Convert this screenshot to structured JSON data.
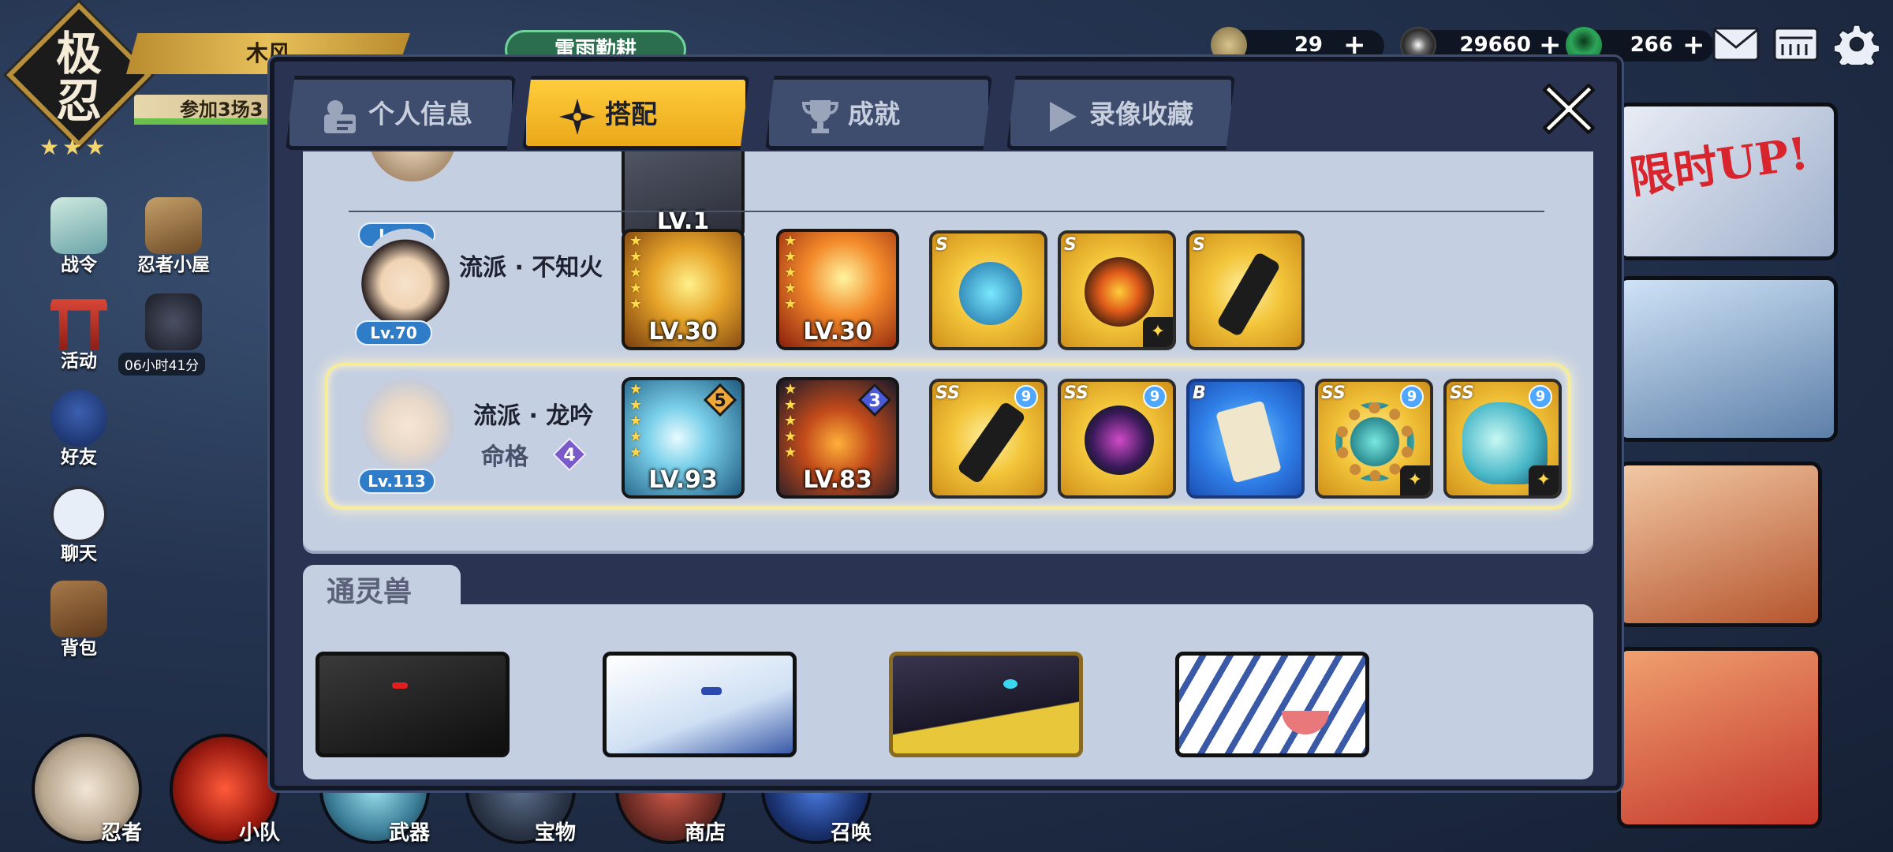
{
  "background": {
    "emblem_glyph_1": "极",
    "emblem_glyph_2": "忍",
    "player_name": "木风",
    "quest_text": "参加3场3",
    "event_pill": "雷雨勤耕",
    "event_banner_text": "限时UP!",
    "side_menu": [
      {
        "label": "战令"
      },
      {
        "label": "忍者小屋"
      },
      {
        "label": "活动"
      },
      {
        "label": "好友"
      },
      {
        "label": "聊天"
      },
      {
        "label": "背包"
      }
    ],
    "side_timer": "06小时41分",
    "bottom_nav": [
      {
        "label": "忍者"
      },
      {
        "label": "小队"
      },
      {
        "label": "武器"
      },
      {
        "label": "宝物"
      },
      {
        "label": "商店"
      },
      {
        "label": "召唤"
      }
    ],
    "currencies": [
      {
        "icon": "coin-icon",
        "value": "29"
      },
      {
        "icon": "silver-coin-icon",
        "value": "29660"
      },
      {
        "icon": "jade-icon",
        "value": "266"
      }
    ]
  },
  "modal": {
    "tabs": [
      {
        "label": "个人信息",
        "icon": "profile-card-icon",
        "active": false
      },
      {
        "label": "搭配",
        "icon": "shuriken-icon",
        "active": true
      },
      {
        "label": "成就",
        "icon": "trophy-icon",
        "active": false
      },
      {
        "label": "录像收藏",
        "icon": "play-icon",
        "active": false
      }
    ],
    "rows": [
      {
        "level": "Lv.1",
        "weapon_level": "LV.1"
      },
      {
        "level": "Lv.70",
        "school": "流派 · 不知火",
        "weapons": [
          {
            "level": "LV.30",
            "stars": 5
          },
          {
            "level": "LV.30",
            "stars": 5
          }
        ],
        "items": [
          {
            "grade": "S",
            "tag": ""
          },
          {
            "grade": "S",
            "tag": "✦"
          },
          {
            "grade": "S",
            "tag": ""
          }
        ]
      },
      {
        "level": "Lv.113",
        "school": "流派 · 龙吟",
        "destiny_label": "命格",
        "destiny_value": "4",
        "selected": true,
        "weapons": [
          {
            "level": "LV.93",
            "stars": 5,
            "rank": "5"
          },
          {
            "level": "LV.83",
            "stars": 5,
            "rank": "3"
          }
        ],
        "items": [
          {
            "grade": "SS",
            "bubble": "9",
            "tag": "",
            "color": "gold"
          },
          {
            "grade": "SS",
            "bubble": "9",
            "tag": "",
            "color": "gold"
          },
          {
            "grade": "B",
            "bubble": "",
            "tag": "",
            "color": "blue"
          },
          {
            "grade": "SS",
            "bubble": "9",
            "tag": "✦",
            "color": "gold"
          },
          {
            "grade": "SS",
            "bubble": "9",
            "tag": "✦",
            "color": "gold"
          }
        ]
      }
    ],
    "beasts_title": "通灵兽",
    "beasts": [
      {
        "name": "black-dragon"
      },
      {
        "name": "white-eagle"
      },
      {
        "name": "dark-raven"
      },
      {
        "name": "white-tiger"
      }
    ]
  },
  "colors": {
    "active_tab": "#f5b82a",
    "panel_bg": "#c5cfe2",
    "modal_bg": "#2a3452",
    "level_badge": "#2f7cc9"
  }
}
